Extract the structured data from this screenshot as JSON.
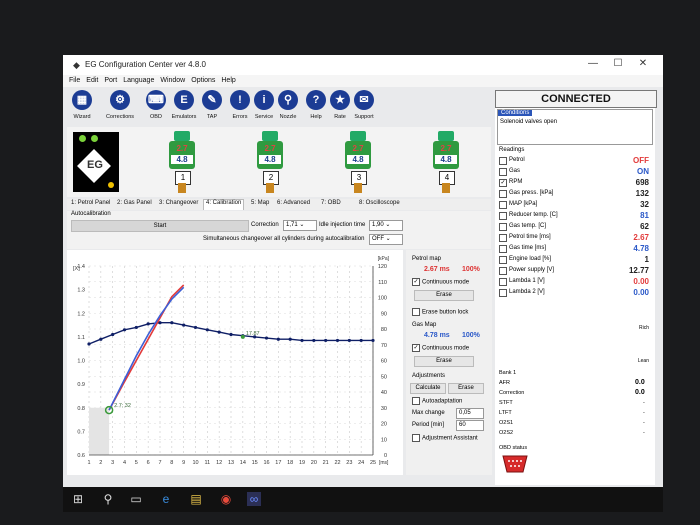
{
  "window": {
    "title": "EG Configuration Center ver 4.8.0",
    "controls": [
      "—",
      "☐",
      "✕"
    ]
  },
  "menu": [
    "File",
    "Edit",
    "Port",
    "Language",
    "Window",
    "Options",
    "Help"
  ],
  "toolbar": [
    {
      "label": "Wizard",
      "icon": "grid-icon",
      "glyph": "▦"
    },
    {
      "label": "Corrections",
      "icon": "gear-icon",
      "glyph": "⚙"
    },
    {
      "label": "OBD",
      "icon": "keyboard-icon",
      "glyph": "⌨"
    },
    {
      "label": "Emulators",
      "icon": "e-icon",
      "glyph": "E"
    },
    {
      "label": "TAP",
      "icon": "wrench-icon",
      "glyph": "✎"
    },
    {
      "label": "Errors",
      "icon": "exclamation-icon",
      "glyph": "!"
    },
    {
      "label": "Service",
      "icon": "info-icon",
      "glyph": "i"
    },
    {
      "label": "Nozzle",
      "icon": "nozzle-icon",
      "glyph": "⚲"
    },
    {
      "label": "Help",
      "icon": "question-icon",
      "glyph": "?"
    },
    {
      "label": "Rate",
      "icon": "star-icon",
      "glyph": "★"
    },
    {
      "label": "Support",
      "icon": "support-icon",
      "glyph": "✉"
    }
  ],
  "logo": {
    "text": "EG"
  },
  "injectors": [
    {
      "petrol": "2.7",
      "gas": "4.8",
      "num": "1"
    },
    {
      "petrol": "2.7",
      "gas": "4.8",
      "num": "2"
    },
    {
      "petrol": "2.7",
      "gas": "4.8",
      "num": "3"
    },
    {
      "petrol": "2.7",
      "gas": "4.8",
      "num": "4"
    }
  ],
  "tabs": [
    "1: Petrol Panel",
    "2: Gas Panel",
    "3: Changeover",
    "4: Calibration",
    "5: Map",
    "6: Advanced",
    "7: OBD",
    "8: Oscilloscope"
  ],
  "active_tab": "4: Calibration",
  "autocal": {
    "heading": "Autocalibration",
    "start": "Start",
    "correction_label": "Correction",
    "correction_value": "1,71",
    "idle_label": "Idle injection time",
    "idle_value": "1,90",
    "simult_label": "Simultaneous changeover all cylinders during autocalibration",
    "simult_value": "OFF"
  },
  "right_panel": {
    "kpa_unit": "[kPa]",
    "petrol_map": "Petrol map",
    "petrol_ms": "2.67 ms",
    "petrol_pct": "100%",
    "continuous": "Continuous mode",
    "erase": "Erase",
    "erase_lock": "Erase button lock",
    "gas_map": "Gas Map",
    "gas_ms": "4.78 ms",
    "gas_pct": "100%",
    "adjustments": "Adjustments",
    "calculate": "Calculate",
    "autoadapt": "Autoadaptation",
    "max_change": "Max change",
    "max_change_val": "0,05",
    "period": "Period [min]",
    "period_val": "60",
    "adj_assistant": "Adjustment Assistant"
  },
  "chart_data": {
    "type": "line",
    "x_ticks": [
      1,
      2,
      3,
      4,
      5,
      6,
      7,
      8,
      9,
      10,
      11,
      12,
      13,
      14,
      15,
      16,
      17,
      18,
      19,
      20,
      21,
      22,
      23,
      24,
      25
    ],
    "x_unit": "[ms]",
    "y_left_label": "[X]",
    "y_left_ticks": [
      "0.6",
      "0.7",
      "0.8",
      "0.9",
      "1.0",
      "1.1",
      "1.2",
      "1.3",
      "1.4"
    ],
    "y_right_ticks": [
      "0",
      "10",
      "20",
      "30",
      "40",
      "50",
      "60",
      "70",
      "80",
      "90",
      "100",
      "110",
      "120"
    ],
    "ylim_left": [
      0.6,
      1.4
    ],
    "annotations": [
      "2.7; 32",
      "17.87"
    ],
    "series": [
      {
        "x": [
          1,
          2,
          3,
          4,
          5,
          6,
          7,
          8,
          9,
          10,
          11,
          12,
          13,
          14,
          15,
          16,
          17,
          18,
          19,
          20,
          21,
          22,
          23,
          24,
          25
        ],
        "y": [
          1.07,
          1.09,
          1.11,
          1.13,
          1.14,
          1.155,
          1.16,
          1.16,
          1.15,
          1.14,
          1.13,
          1.12,
          1.11,
          1.105,
          1.1,
          1.095,
          1.09,
          1.09,
          1.085,
          1.085,
          1.085,
          1.085,
          1.085,
          1.085,
          1.085
        ]
      },
      {
        "x": [
          2.7,
          4,
          5,
          6,
          7,
          8,
          9
        ],
        "y": [
          0.79,
          0.91,
          1.0,
          1.09,
          1.18,
          1.27,
          1.32
        ]
      },
      {
        "x": [
          2.7,
          4,
          5,
          6,
          7,
          8,
          9
        ],
        "y": [
          0.79,
          0.92,
          1.02,
          1.11,
          1.19,
          1.26,
          1.31
        ]
      }
    ],
    "grid": true
  },
  "readings": {
    "status": "CONNECTED",
    "conditions_label": "Conditions",
    "conditions_text": "Solenoid valves open",
    "heading": "Readings",
    "items": [
      {
        "name": "Petrol",
        "value": "OFF",
        "color": "#e23b3b",
        "checked": false
      },
      {
        "name": "Gas",
        "value": "ON",
        "color": "#2a58c8",
        "checked": false
      },
      {
        "name": "RPM",
        "value": "698",
        "color": "#222222",
        "checked": true
      },
      {
        "name": "Gas press. [kPa]",
        "value": "132",
        "color": "#222222",
        "checked": false
      },
      {
        "name": "MAP [kPa]",
        "value": "32",
        "color": "#222222",
        "checked": false
      },
      {
        "name": "Reducer temp. [C]",
        "value": "81",
        "color": "#2a58c8",
        "checked": false
      },
      {
        "name": "Gas temp. [C]",
        "value": "62",
        "color": "#222222",
        "checked": false
      },
      {
        "name": "Petrol time [ms]",
        "value": "2.67",
        "color": "#e23b3b",
        "checked": false
      },
      {
        "name": "Gas time [ms]",
        "value": "4.78",
        "color": "#2a58c8",
        "checked": false
      },
      {
        "name": "Engine load [%]",
        "value": "1",
        "color": "#222222",
        "checked": false
      },
      {
        "name": "Power supply [V]",
        "value": "12.77",
        "color": "#222222",
        "checked": false
      },
      {
        "name": "Lambda 1 [V]",
        "value": "0.00",
        "color": "#e23b3b",
        "checked": false
      },
      {
        "name": "Lambda 2 [V]",
        "value": "0.00",
        "color": "#2a58c8",
        "checked": false
      }
    ],
    "rich": "Rich",
    "lean": "Lean",
    "bank_label": "Bank 1",
    "afr": "AFR",
    "afr_val": "0.0",
    "correction": "Correction",
    "correction_val": "0.0",
    "stft": "STFT",
    "ltft": "LTFT",
    "o2s1": "O2S1",
    "o2s2": "O2S2",
    "dash": "-",
    "obd_status": "OBD status"
  }
}
